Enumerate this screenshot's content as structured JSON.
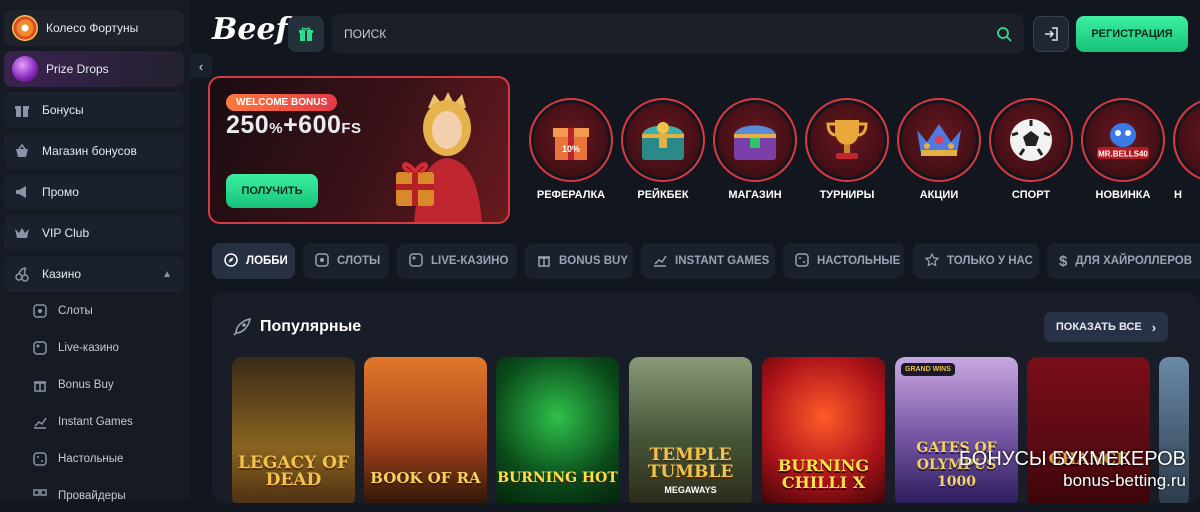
{
  "sidebar": {
    "wheel": "Колесо Фортуны",
    "prize_drops": "Prize Drops",
    "items": [
      "Бонусы",
      "Магазин бонусов",
      "Промо",
      "VIP Club"
    ],
    "casino": {
      "label": "Казино",
      "sub": [
        "Слоты",
        "Live-казино",
        "Bonus Buy",
        "Instant Games",
        "Настольные",
        "Провайдеры"
      ]
    }
  },
  "header": {
    "logo": "Beef",
    "search_placeholder": "ПОИСК",
    "register": "РЕГИСТРАЦИЯ"
  },
  "banner": {
    "badge": "WELCOME BONUS",
    "amount_a": "250",
    "unit_a": "%",
    "amount_b": "+600",
    "unit_b": "FS",
    "button": "ПОЛУЧИТЬ"
  },
  "stories": [
    {
      "label": "РЕФЕРАЛКА",
      "icon": "gift-box-icon",
      "badge": "10%"
    },
    {
      "label": "РЕЙКБЕК",
      "icon": "treasure-chest-icon"
    },
    {
      "label": "МАГАЗИН",
      "icon": "chest-icon"
    },
    {
      "label": "ТУРНИРЫ",
      "icon": "trophy-icon"
    },
    {
      "label": "АКЦИИ",
      "icon": "crown-icon"
    },
    {
      "label": "СПОРТ",
      "icon": "soccer-ball-icon"
    },
    {
      "label": "НОВИНКА",
      "icon": "mr-bells-icon",
      "badge": "MR.BELLS40"
    },
    {
      "label": "Н",
      "icon": "partial-icon"
    }
  ],
  "tabs": [
    {
      "label": "ЛОББИ",
      "icon": "compass-icon"
    },
    {
      "label": "СЛОТЫ",
      "icon": "slot-icon"
    },
    {
      "label": "LIVE-КАЗИНО",
      "icon": "live-icon"
    },
    {
      "label": "BONUS BUY",
      "icon": "gift-icon"
    },
    {
      "label": "INSTANT GAMES",
      "icon": "chart-icon"
    },
    {
      "label": "НАСТОЛЬНЫЕ",
      "icon": "dice-icon"
    },
    {
      "label": "ТОЛЬКО У НАС",
      "icon": "star-icon"
    },
    {
      "label": "ДЛЯ ХАЙРОЛЛЕРОВ",
      "icon": "dollar-icon"
    }
  ],
  "popular": {
    "title": "Популярные",
    "show_all": "ПОКАЗАТЬ ВСЕ",
    "games": [
      {
        "name": "LEGACY OF DEAD"
      },
      {
        "name": "BOOK OF RA"
      },
      {
        "name": "BURNING HOT"
      },
      {
        "name": "TEMPLE TUMBLE",
        "sub": "MEGAWAYS"
      },
      {
        "name": "BURNING CHILLI X"
      },
      {
        "name": "GATES OF OLYMPUS 1000",
        "badge": "GRAND WINS"
      },
      {
        "name": "CHANCE"
      },
      {
        "name": ""
      }
    ]
  },
  "watermark": {
    "line1": "БОНУСЫ БУКМЕКЕРОВ",
    "line2": "bonus-betting.ru"
  },
  "colors": {
    "accent": "#2ddc8e",
    "banner_border": "#d63a42",
    "ring": "#e0363f"
  }
}
